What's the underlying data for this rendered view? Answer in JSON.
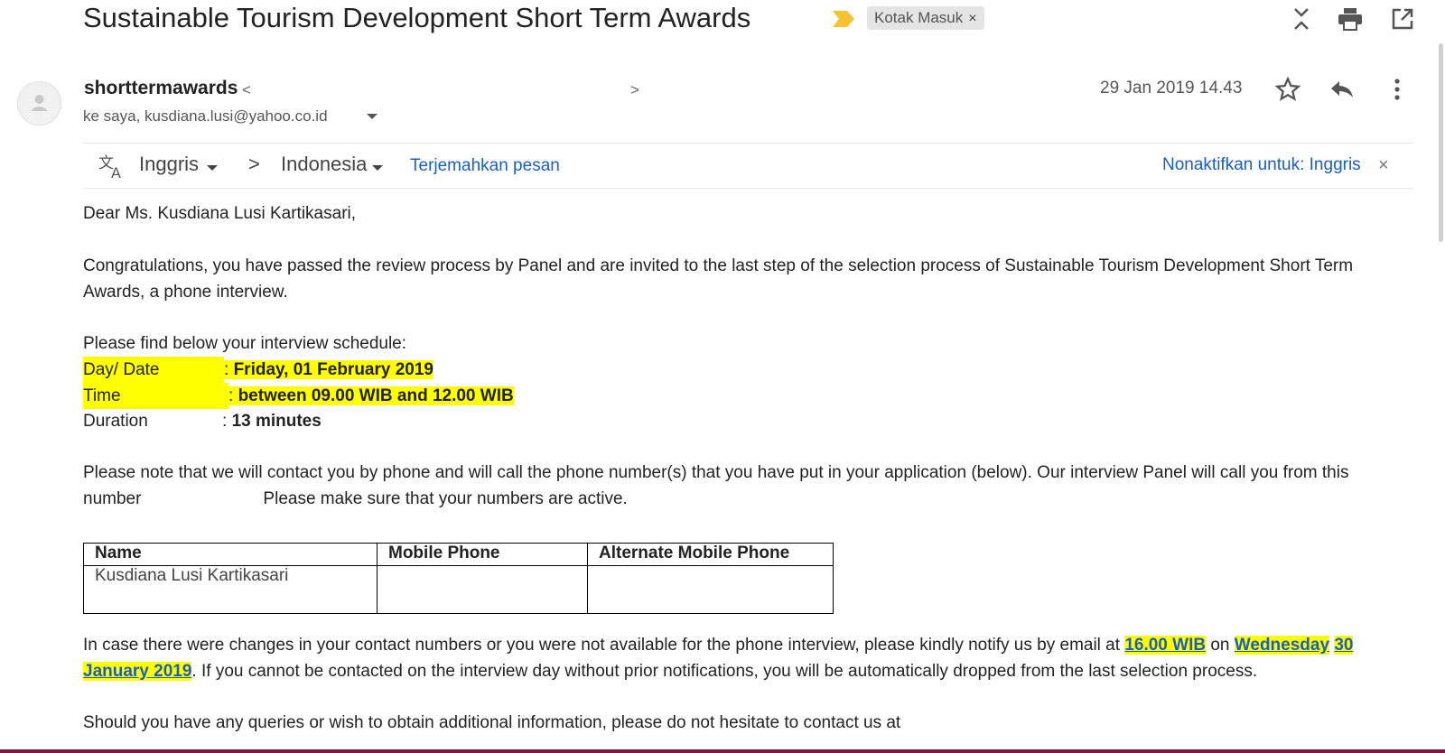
{
  "subject": "Sustainable Tourism Development Short Term Awards",
  "label_chip": {
    "text": "Kotak Masuk",
    "close": "×"
  },
  "top_icons": [
    "collapse-expand-icon",
    "print-icon",
    "open-new-window-icon"
  ],
  "sender": {
    "name": "shorttermawards",
    "lt": "<",
    "gt": ">"
  },
  "recipients": "ke saya, kusdiana.lusi@yahoo.co.id",
  "datetime": "29 Jan 2019 14.43",
  "header_icons": [
    "star-icon",
    "reply-icon",
    "more-vert-icon"
  ],
  "translate_bar": {
    "from_lang": "Inggris",
    "arrow": ">",
    "to_lang": "Indonesia",
    "translate_link": "Terjemahkan pesan",
    "disable_link": "Nonaktifkan untuk: Inggris",
    "close": "×"
  },
  "body": {
    "greeting": "Dear Ms. Kusdiana Lusi Kartikasari,",
    "para1": "Congratulations, you have passed the review process by Panel and are invited to the last step of the selection process of Sustainable Tourism Development Short Term Awards, a phone interview.",
    "schedule_intro": "Please find below your interview schedule:",
    "schedule": [
      {
        "label": "Day/ Date",
        "sep": ": ",
        "value": "Friday, 01 February 2019",
        "highlight": true
      },
      {
        "label": "Time",
        "sep": ": ",
        "value": "between 09.00 WIB and 12.00 WIB",
        "highlight": true
      },
      {
        "label": "Duration",
        "sep": ": ",
        "value": "13 minutes",
        "highlight": false
      }
    ],
    "para2_a": "Please note that we will contact you by phone and will call the phone number(s) that you have put in your application (below). Our interview Panel will call you from this number",
    "para2_b": "Please make sure that your numbers are active.",
    "table": {
      "headers": [
        "Name",
        "Mobile Phone",
        "Alternate Mobile Phone"
      ],
      "rows": [
        [
          "Kusdiana Lusi Kartikasari",
          "",
          ""
        ]
      ]
    },
    "para3_a": "In case there were changes in your contact numbers or you were not available for the phone interview, please kindly notify us by email at",
    "para3_time": "16.00 WIB",
    "para3_on": "on",
    "para3_date1": "Wednesday",
    "para3_date2": "30 January 2019",
    "para3_b": ". If you cannot be contacted on the interview day without prior notifications, you will be automatically dropped from the last selection process.",
    "para4": "Should you have any queries or wish to obtain additional information, please do not hesitate to contact us at"
  },
  "colors": {
    "highlight": "#ffff00",
    "link": "#1a5dc4",
    "important_marker": "#f4c430"
  }
}
